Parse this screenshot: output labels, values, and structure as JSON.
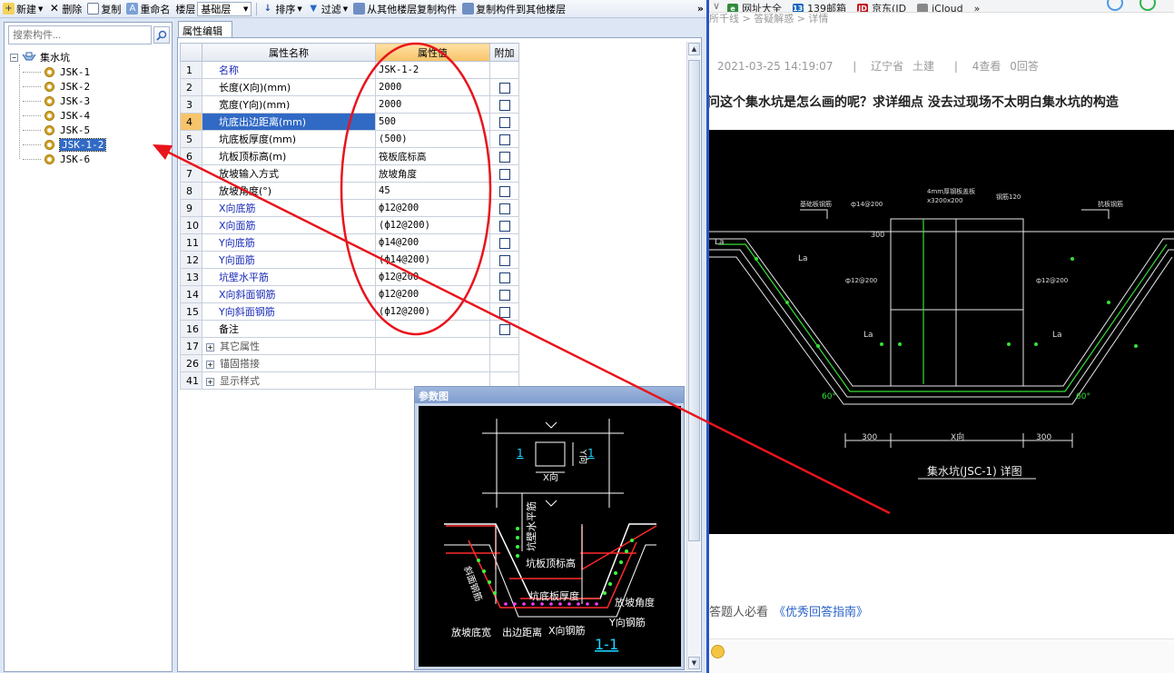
{
  "toolbar": {
    "new": "新建",
    "delete": "删除",
    "copy": "复制",
    "rename": "重命名",
    "floor_label": "楼层",
    "floor_value": "基础层",
    "sort": "排序",
    "filter": "过滤",
    "copy_from_floor": "从其他楼层复制构件",
    "copy_to_floor": "复制构件到其他楼层",
    "more": "»"
  },
  "search": {
    "placeholder": "搜索构件..."
  },
  "tree": {
    "root": "集水坑",
    "items": [
      "JSK-1",
      "JSK-2",
      "JSK-3",
      "JSK-4",
      "JSK-5",
      "JSK-1-2",
      "JSK-6"
    ],
    "selected": "JSK-1-2"
  },
  "props": {
    "tab": "属性编辑",
    "headers": {
      "name": "属性名称",
      "value": "属性值",
      "extra": "附加"
    },
    "rows": [
      {
        "num": "1",
        "name": "名称",
        "value": "JSK-1-2",
        "blue": true,
        "check": false
      },
      {
        "num": "2",
        "name": "长度(X向)(mm)",
        "value": "2000",
        "blue": false,
        "check": true
      },
      {
        "num": "3",
        "name": "宽度(Y向)(mm)",
        "value": "2000",
        "blue": false,
        "check": true
      },
      {
        "num": "4",
        "name": "坑底出边距离(mm)",
        "value": "500",
        "blue": false,
        "check": true,
        "selected": true
      },
      {
        "num": "5",
        "name": "坑底板厚度(mm)",
        "value": "(500)",
        "blue": false,
        "check": true
      },
      {
        "num": "6",
        "name": "坑板顶标高(m)",
        "value": "筏板底标高",
        "blue": false,
        "check": true
      },
      {
        "num": "7",
        "name": "放坡输入方式",
        "value": "放坡角度",
        "blue": false,
        "check": true
      },
      {
        "num": "8",
        "name": "放坡角度(°)",
        "value": "45",
        "blue": false,
        "check": true
      },
      {
        "num": "9",
        "name": "X向底筋",
        "value": "ф12@200",
        "blue": true,
        "check": true
      },
      {
        "num": "10",
        "name": "X向面筋",
        "value": "(ф12@200)",
        "blue": true,
        "check": true
      },
      {
        "num": "11",
        "name": "Y向底筋",
        "value": "ф14@200",
        "blue": true,
        "check": true
      },
      {
        "num": "12",
        "name": "Y向面筋",
        "value": "(ф14@200)",
        "blue": true,
        "check": true
      },
      {
        "num": "13",
        "name": "坑壁水平筋",
        "value": "ф12@200",
        "blue": true,
        "check": true
      },
      {
        "num": "14",
        "name": "X向斜面钢筋",
        "value": "ф12@200",
        "blue": true,
        "check": true
      },
      {
        "num": "15",
        "name": "Y向斜面钢筋",
        "value": "(ф12@200)",
        "blue": true,
        "check": true
      },
      {
        "num": "16",
        "name": "备注",
        "value": "",
        "blue": false,
        "check": true
      }
    ],
    "groups": [
      {
        "num": "17",
        "name": "其它属性"
      },
      {
        "num": "26",
        "name": "锚固搭接"
      },
      {
        "num": "41",
        "name": "显示样式"
      }
    ]
  },
  "param_window": {
    "title": "参数图",
    "labels": {
      "x_dir": "X向",
      "y_dir": "Y向",
      "section_mark": "1",
      "wall_horizontal_bar": "坑壁水平筋",
      "slab_top_elev": "坑板顶标高",
      "slab_thickness": "坑底板厚度",
      "slope_angle": "放坡角度",
      "y_bar": "Y向钢筋",
      "slope_bottom_width": "放坡底宽",
      "edge_distance": "出边距离",
      "x_bar": "X向钢筋",
      "slope_bar": "斜面钢筋",
      "section_name": "1-1"
    }
  },
  "browser": {
    "bookmarks": [
      "网址大全",
      "139邮箱",
      "京东(JD",
      "iCloud",
      "»"
    ],
    "breadcrumb": "所千线 > 答疑解惑 > 详情",
    "date": "2021-03-25 14:19:07",
    "sep": "|",
    "region": "辽宁省",
    "category": "土建",
    "views": "4查看",
    "answers": "0回答",
    "question": "问这个集水坑是怎么画的呢？求详细点 没去过现场不太明白集水坑的构造",
    "hint_prefix": "答题人必看",
    "hint_link": "《优秀回答指南》"
  },
  "cad": {
    "title": "集水坑(JSC-1) 详图",
    "dim_300": "300",
    "dim_x": "X向",
    "angle": "60°",
    "la": "La",
    "notes": [
      "4mm厚钢板盖板",
      "x3200x200",
      "钢筋120",
      "基础板钢筋",
      "抗板钢筋",
      "ф14@200",
      "ф12@200",
      "ф12@200"
    ]
  },
  "colors": {
    "annotation": "#e8141c",
    "selection": "#316ac5",
    "accent_header": "#f7c46a"
  }
}
